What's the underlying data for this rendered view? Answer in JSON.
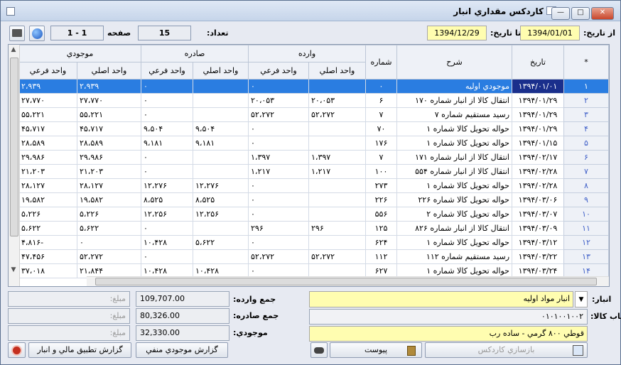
{
  "window": {
    "title": "کاردکس مقداري انبار",
    "btn_close": "✕",
    "btn_max": "□",
    "btn_min": "—"
  },
  "toolbar": {
    "from_date_label": "از تاریخ:",
    "from_date": "1394/01/01",
    "to_date_label": "تا تاریخ:",
    "to_date": "1394/12/29",
    "count_label": "تعداد:",
    "count": "15",
    "page_label": "صفحه",
    "page": "1 - 1"
  },
  "grid": {
    "headers": {
      "star": "*",
      "date": "تاریخ",
      "desc": "شرح",
      "number": "شماره",
      "incoming": "وارده",
      "outgoing": "صادره",
      "stock": "موجودي",
      "main_unit": "واحد اصلي",
      "sub_unit": "واحد فرعي"
    },
    "rows": [
      {
        "i": "۱",
        "date": "۱۳۹۴/۰۱/۰۱",
        "desc": "موجودي اوليه",
        "no": "۰",
        "in_m": "",
        "in_s": "۰",
        "out_m": "",
        "out_s": "۰",
        "st_m": "۲،۹۳۹",
        "st_s": "۲،۹۳۹"
      },
      {
        "i": "۲",
        "date": "۱۳۹۴/۰۱/۲۹",
        "desc": "انتقال کالا از انبار شماره ۱۷۰",
        "no": "۶",
        "in_m": "۲۰،۰۵۳",
        "in_s": "۲۰،۰۵۳",
        "out_m": "",
        "out_s": "۰",
        "st_m": "۲۷،۷۷۰",
        "st_s": "۲۷،۷۷۰"
      },
      {
        "i": "۳",
        "date": "۱۳۹۴/۰۱/۲۹",
        "desc": "رسيد مستقيم شماره ۷",
        "no": "۷",
        "in_m": "۵۲،۲۷۲",
        "in_s": "۵۲،۲۷۲",
        "out_m": "",
        "out_s": "۰",
        "st_m": "۵۵،۲۲۱",
        "st_s": "۵۵،۲۲۱"
      },
      {
        "i": "۴",
        "date": "۱۳۹۴/۰۱/۲۹",
        "desc": "حواله تحويل کالا شماره ۱",
        "no": "۷۰",
        "in_m": "",
        "in_s": "۰",
        "out_m": "۹،۵۰۴",
        "out_s": "۹،۵۰۴",
        "st_m": "۴۵،۷۱۷",
        "st_s": "۴۵،۷۱۷"
      },
      {
        "i": "۵",
        "date": "۱۳۹۴/۰۱/۱۵",
        "desc": "حواله تحويل کالا شماره ۱",
        "no": "۱۷۶",
        "in_m": "",
        "in_s": "۰",
        "out_m": "۹،۱۸۱",
        "out_s": "۹،۱۸۱",
        "st_m": "۲۸،۵۸۹",
        "st_s": "۲۸،۵۸۹"
      },
      {
        "i": "۶",
        "date": "۱۳۹۴/۰۲/۱۷",
        "desc": "انتقال کالا از انبار شماره ۱۷۱",
        "no": "۷",
        "in_m": "۱،۳۹۷",
        "in_s": "۱،۳۹۷",
        "out_m": "",
        "out_s": "۰",
        "st_m": "۲۹،۹۸۶",
        "st_s": "۲۹،۹۸۶"
      },
      {
        "i": "۷",
        "date": "۱۳۹۴/۰۲/۲۸",
        "desc": "انتقال کالا از انبار شماره ۵۵۴",
        "no": "۱۰۰",
        "in_m": "۱،۲۱۷",
        "in_s": "۱،۲۱۷",
        "out_m": "",
        "out_s": "۰",
        "st_m": "۲۱،۲۰۳",
        "st_s": "۲۱،۲۰۳"
      },
      {
        "i": "۸",
        "date": "۱۳۹۴/۰۲/۲۸",
        "desc": "حواله تحويل کالا شماره ۱",
        "no": "۲۷۳",
        "in_m": "",
        "in_s": "۰",
        "out_m": "۱۲،۲۷۶",
        "out_s": "۱۲،۲۷۶",
        "st_m": "۲۸،۱۲۷",
        "st_s": "۲۸،۱۲۷"
      },
      {
        "i": "۹",
        "date": "۱۳۹۴/۰۳/۰۶",
        "desc": "حواله تحويل کالا شماره ۲۲۶",
        "no": "۲۲۶",
        "in_m": "",
        "in_s": "۰",
        "out_m": "۸،۵۲۵",
        "out_s": "۸،۵۲۵",
        "st_m": "۱۹،۵۸۲",
        "st_s": "۱۹،۵۸۲"
      },
      {
        "i": "۱۰",
        "date": "۱۳۹۴/۰۳/۰۷",
        "desc": "حواله تحويل کالا شماره ۲",
        "no": "۵۵۶",
        "in_m": "",
        "in_s": "۰",
        "out_m": "۱۲،۲۵۶",
        "out_s": "۱۲،۲۵۶",
        "st_m": "۵،۲۲۶",
        "st_s": "۵،۲۲۶"
      },
      {
        "i": "۱۱",
        "date": "۱۳۹۴/۰۳/۰۹",
        "desc": "انتقال کالا از انبار شماره ۸۲۶",
        "no": "۱۲۵",
        "in_m": "۲۹۶",
        "in_s": "۲۹۶",
        "out_m": "",
        "out_s": "۰",
        "st_m": "۵،۶۲۲",
        "st_s": "۵،۶۲۲"
      },
      {
        "i": "۱۲",
        "date": "۱۳۹۴/۰۳/۱۲",
        "desc": "حواله تحويل کالا شماره ۱",
        "no": "۶۲۴",
        "in_m": "",
        "in_s": "۰",
        "out_m": "۵،۶۲۲",
        "out_s": "۱۰،۴۲۸",
        "st_m": "۰",
        "st_s": "-۴،۸۱۶"
      },
      {
        "i": "۱۳",
        "date": "۱۳۹۴/۰۳/۲۲",
        "desc": "رسيد مستقيم شماره ۱۱۲",
        "no": "۱۱۲",
        "in_m": "۵۲،۲۷۲",
        "in_s": "۵۲،۲۷۲",
        "out_m": "",
        "out_s": "۰",
        "st_m": "۵۲،۲۷۲",
        "st_s": "۴۷،۴۵۶"
      },
      {
        "i": "۱۴",
        "date": "۱۳۹۴/۰۳/۲۴",
        "desc": "حواله تحويل کالا شماره ۱",
        "no": "۶۲۷",
        "in_m": "",
        "in_s": "۰",
        "out_m": "۱۰،۴۲۸",
        "out_s": "۱۰،۴۲۸",
        "st_m": "۲۱،۸۴۴",
        "st_s": "۳۷،۰۱۸"
      }
    ]
  },
  "footer": {
    "store_label": "انبار:",
    "store_value": "انبار مواد اوليه",
    "item_label": "انتخاب کالا:",
    "item_code": "۰۱۰۱۰۰۱۰۰۲",
    "item_desc": "قوطي ۸۰۰ گرمي - ساده رب",
    "sum_in_label": "جمع وارده:",
    "sum_in": "109,707.00",
    "sum_out_label": "جمع صادره:",
    "sum_out": "80,326.00",
    "stock_label": "موجودي:",
    "stock": "32,330.00",
    "amount_placeholder": "مبلغ:",
    "btn_rebuild": "بازسازي کاردکس",
    "btn_attach": "پيوست",
    "btn_neg_stock": "گزارش موجودي منفي",
    "btn_reconcile": "گزارش تطبيق مالي و انبار"
  }
}
